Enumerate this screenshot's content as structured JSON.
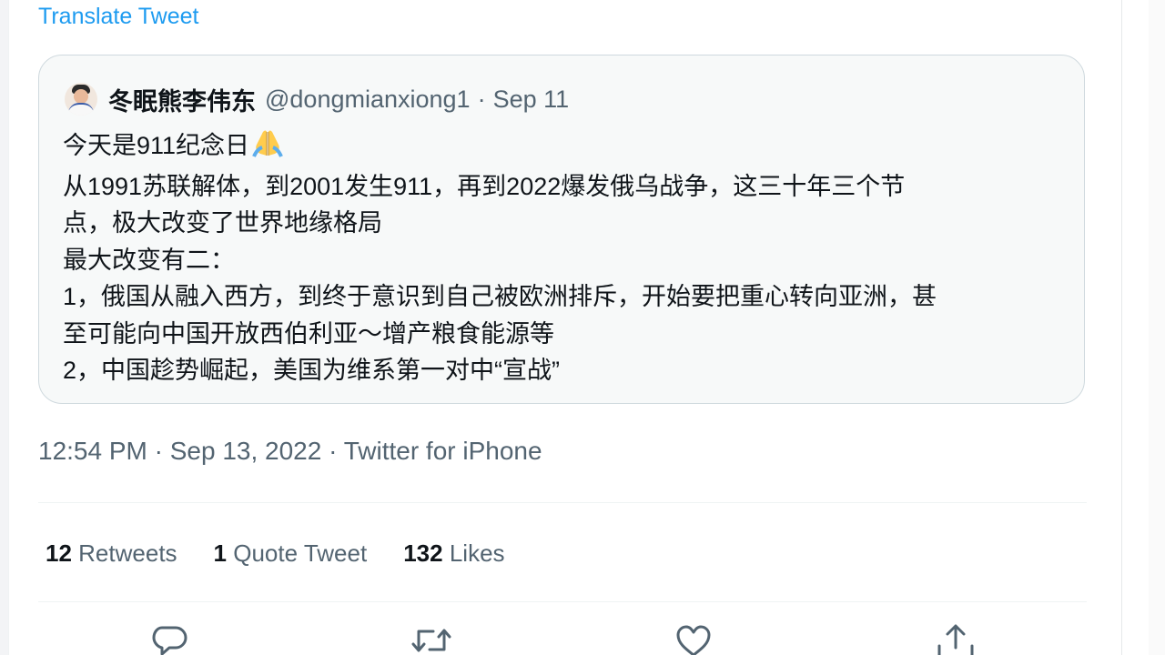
{
  "translate_link": "Translate Tweet",
  "quoted_tweet": {
    "display_name": "冬眠熊李伟东",
    "handle": "@dongmianxiong1",
    "separator": "·",
    "date": "Sep 11",
    "lines": [
      "今天是911纪念日",
      "从1991苏联解体，到2001发生911，再到2022爆发俄乌战争，这三十年三个节",
      "点，极大改变了世界地缘格局",
      "最大改变有二：",
      "1，俄国从融入西方，到终于意识到自己被欧洲排斥，开始要把重心转向亚洲，甚",
      "至可能向中国开放西伯利亚～增产粮食能源等",
      "2，中国趁势崛起，美国为维系第一对中“宣战”"
    ],
    "emoji": "folded-hands"
  },
  "timestamp": "12:54 PM · Sep 13, 2022 · Twitter for iPhone",
  "stats": {
    "retweets": {
      "count": "12",
      "label": "Retweets"
    },
    "quotes": {
      "count": "1",
      "label": "Quote Tweet"
    },
    "likes": {
      "count": "132",
      "label": "Likes"
    }
  },
  "actions": [
    "reply-icon",
    "retweet-icon",
    "like-icon",
    "share-icon"
  ],
  "colors": {
    "link": "#1d9bf0",
    "text_primary": "#0f1419",
    "text_secondary": "#536471",
    "border": "#cfd9de",
    "card_bg": "#f7f9f9"
  }
}
